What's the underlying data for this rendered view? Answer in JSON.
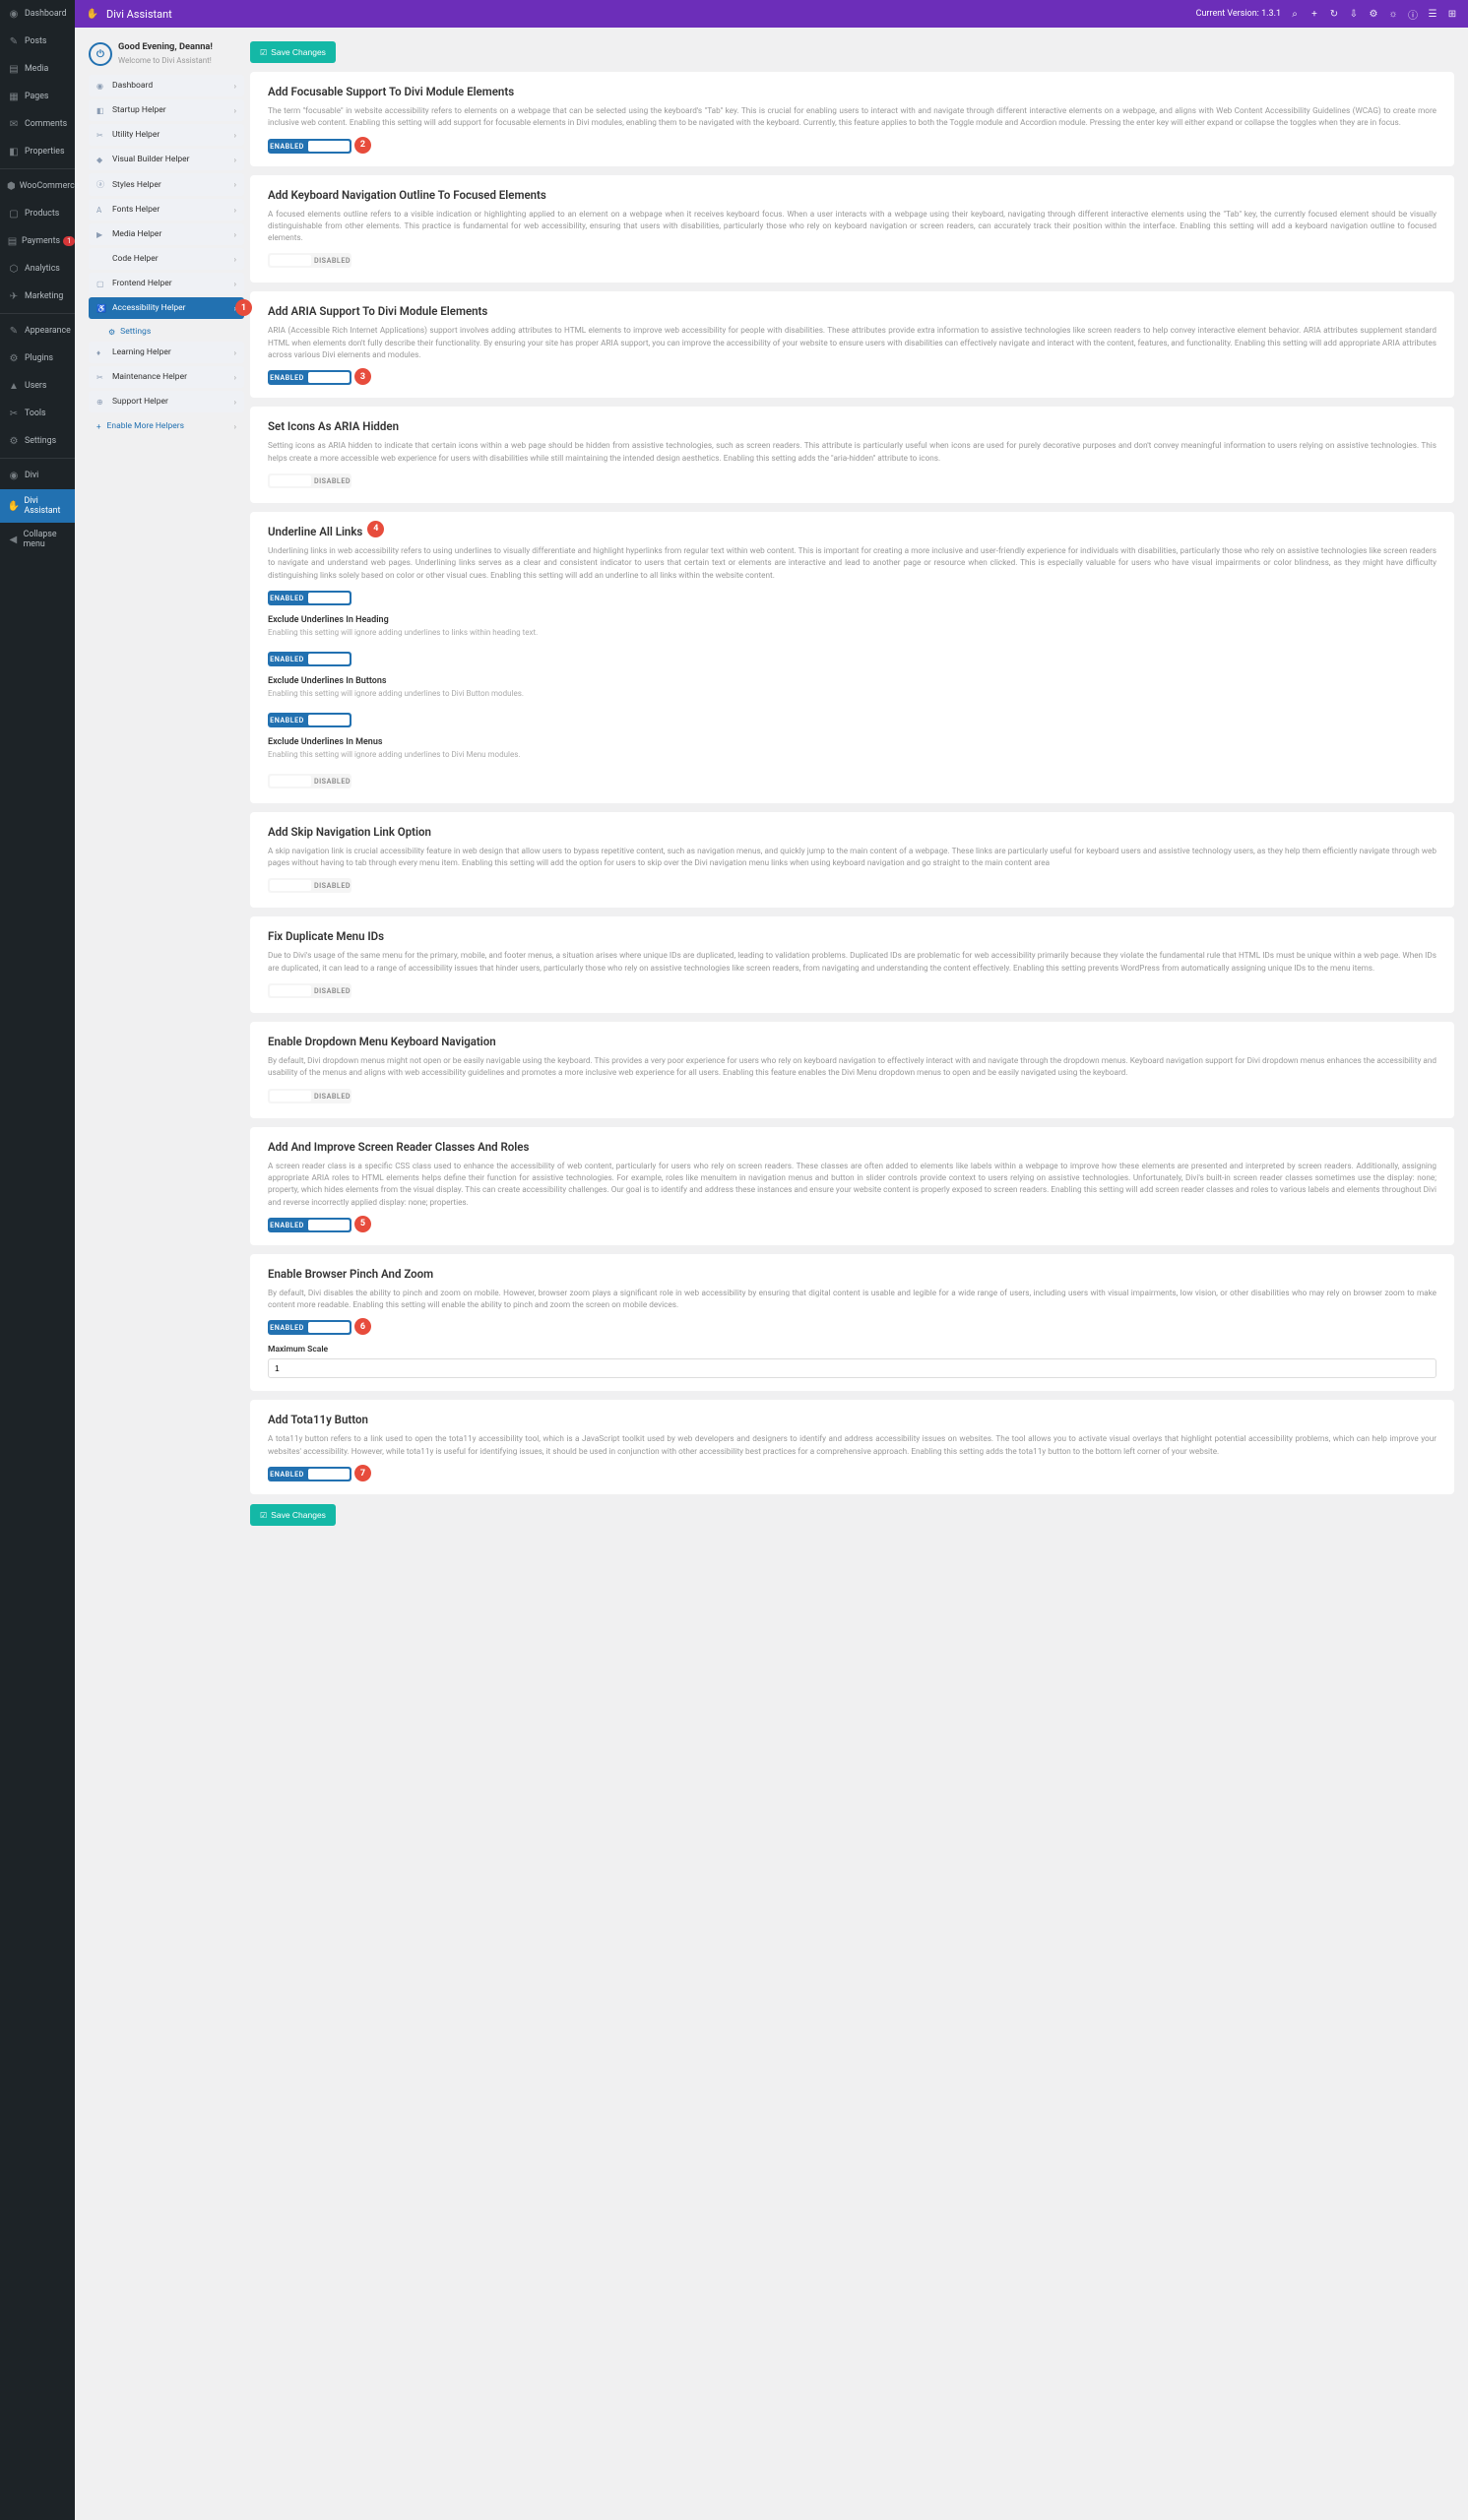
{
  "wp_menu": [
    {
      "icon": "◉",
      "label": "Dashboard",
      "badge": null
    },
    {
      "icon": "✎",
      "label": "Posts",
      "badge": null
    },
    {
      "icon": "▤",
      "label": "Media",
      "badge": null
    },
    {
      "icon": "▦",
      "label": "Pages",
      "badge": null
    },
    {
      "icon": "✉",
      "label": "Comments",
      "badge": null
    },
    {
      "icon": "◧",
      "label": "Properties",
      "badge": null
    },
    {
      "icon": "-",
      "label": "",
      "badge": null
    },
    {
      "icon": "⬢",
      "label": "WooCommerce",
      "badge": null
    },
    {
      "icon": "▢",
      "label": "Products",
      "badge": null
    },
    {
      "icon": "▤",
      "label": "Payments",
      "badge": "1"
    },
    {
      "icon": "⬡",
      "label": "Analytics",
      "badge": null
    },
    {
      "icon": "✈",
      "label": "Marketing",
      "badge": null
    },
    {
      "icon": "-",
      "label": "",
      "badge": null
    },
    {
      "icon": "✎",
      "label": "Appearance",
      "badge": null
    },
    {
      "icon": "⚙",
      "label": "Plugins",
      "badge": null
    },
    {
      "icon": "▲",
      "label": "Users",
      "badge": null
    },
    {
      "icon": "✂",
      "label": "Tools",
      "badge": null
    },
    {
      "icon": "⚙",
      "label": "Settings",
      "badge": null
    },
    {
      "icon": "-",
      "label": "",
      "badge": null
    },
    {
      "icon": "◉",
      "label": "Divi",
      "badge": null
    },
    {
      "icon": "✋",
      "label": "Divi Assistant",
      "badge": null,
      "active": true
    },
    {
      "icon": "◀",
      "label": "Collapse menu",
      "badge": null
    }
  ],
  "topbar": {
    "title": "Divi Assistant",
    "version_label": "Current Version:",
    "version": "1.3.1"
  },
  "greeting": {
    "title": "Good Evening, Deanna!",
    "sub": "Welcome to Divi Assistant!"
  },
  "helpers": [
    {
      "icon": "◉",
      "label": "Dashboard"
    },
    {
      "icon": "◧",
      "label": "Startup Helper"
    },
    {
      "icon": "✂",
      "label": "Utility Helper"
    },
    {
      "icon": "◆",
      "label": "Visual Builder Helper"
    },
    {
      "icon": "ⓐ",
      "label": "Styles Helper"
    },
    {
      "icon": "A",
      "label": "Fonts Helper"
    },
    {
      "icon": "▶",
      "label": "Media Helper"
    },
    {
      "icon": "</>",
      "label": "Code Helper"
    },
    {
      "icon": "▢",
      "label": "Frontend Helper"
    },
    {
      "icon": "♿",
      "label": "Accessibility Helper",
      "active": true
    },
    {
      "icon": "⚙",
      "label": "Settings",
      "sub": true
    },
    {
      "icon": "♦",
      "label": "Learning Helper"
    },
    {
      "icon": "✂",
      "label": "Maintenance Helper"
    },
    {
      "icon": "⊕",
      "label": "Support Helper"
    }
  ],
  "enable_more": {
    "label": "Enable More Helpers"
  },
  "save_label": "Save Changes",
  "badges": [
    "1",
    "2",
    "3",
    "4",
    "5",
    "6",
    "7"
  ],
  "sections": [
    {
      "title": "Add Focusable Support To Divi Module Elements",
      "desc": "The term \"focusable\" in website accessibility refers to elements on a webpage that can be selected using the keyboard's \"Tab\" key. This is crucial for enabling users to interact with and navigate through different interactive elements on a webpage, and aligns with Web Content Accessibility Guidelines (WCAG) to create more inclusive web content. Enabling this setting will add support for focusable elements in Divi modules, enabling them to be navigated with the keyboard. Currently, this feature applies to both the Toggle module and Accordion module. Pressing the enter key will either expand or collapse the toggles when they are in focus.",
      "state": "on",
      "badge": "2"
    },
    {
      "title": "Add Keyboard Navigation Outline To Focused Elements",
      "desc": "A focused elements outline refers to a visible indication or highlighting applied to an element on a webpage when it receives keyboard focus. When a user interacts with a webpage using their keyboard, navigating through different interactive elements using the \"Tab\" key, the currently focused element should be visually distinguishable from other elements. This practice is fundamental for web accessibility, ensuring that users with disabilities, particularly those who rely on keyboard navigation or screen readers, can accurately track their position within the interface. Enabling this setting will add a keyboard navigation outline to focused elements.",
      "state": "off"
    },
    {
      "title": "Add ARIA Support To Divi Module Elements",
      "desc": "ARIA (Accessible Rich Internet Applications) support involves adding attributes to HTML elements to improve web accessibility for people with disabilities. These attributes provide extra information to assistive technologies like screen readers to help convey interactive element behavior. ARIA attributes supplement standard HTML when elements don't fully describe their functionality. By ensuring your site has proper ARIA support, you can improve the accessibility of your website to ensure users with disabilities can effectively navigate and interact with the content, features, and functionality. Enabling this setting will add appropriate ARIA attributes across various Divi elements and modules.",
      "state": "on",
      "badge": "3"
    },
    {
      "title": "Set Icons As ARIA Hidden",
      "desc": "Setting icons as ARIA hidden to indicate that certain icons within a web page should be hidden from assistive technologies, such as screen readers. This attribute is particularly useful when icons are used for purely decorative purposes and don't convey meaningful information to users relying on assistive technologies. This helps create a more accessible web experience for users with disabilities while still maintaining the intended design aesthetics. Enabling this setting adds the \"aria-hidden\" attribute to icons.",
      "state": "off"
    },
    {
      "title": "Underline All Links",
      "title_badge": "4",
      "desc": "Underlining links in web accessibility refers to using underlines to visually differentiate and highlight hyperlinks from regular text within web content. This is important for creating a more inclusive and user-friendly experience for individuals with disabilities, particularly those who rely on assistive technologies like screen readers to navigate and understand web pages. Underlining links serves as a clear and consistent indicator to users that certain text or elements are interactive and lead to another page or resource when clicked. This is especially valuable for users who have visual impairments or color blindness, as they might have difficulty distinguishing links solely based on color or other visual cues. Enabling this setting will add an underline to all links within the website content.",
      "state": "on",
      "subs": [
        {
          "title": "Exclude Underlines In Heading",
          "note": "Enabling this setting will ignore adding underlines to links within heading text.",
          "state": "on"
        },
        {
          "title": "Exclude Underlines In Buttons",
          "note": "Enabling this setting will ignore adding underlines to Divi Button modules.",
          "state": "on"
        },
        {
          "title": "Exclude Underlines In Menus",
          "note": "Enabling this setting will ignore adding underlines to Divi Menu modules.",
          "state": "off"
        }
      ]
    },
    {
      "title": "Add Skip Navigation Link Option",
      "desc": "A skip navigation link is crucial accessibility feature in web design that allow users to bypass repetitive content, such as navigation menus, and quickly jump to the main content of a webpage. These links are particularly useful for keyboard users and assistive technology users, as they help them efficiently navigate through web pages without having to tab through every menu item. Enabling this setting will add the option for users to skip over the Divi navigation menu links when using keyboard navigation and go straight to the main content area",
      "state": "off"
    },
    {
      "title": "Fix Duplicate Menu IDs",
      "desc": "Due to Divi's usage of the same menu for the primary, mobile, and footer menus, a situation arises where unique IDs are duplicated, leading to validation problems. Duplicated IDs are problematic for web accessibility primarily because they violate the fundamental rule that HTML IDs must be unique within a web page. When IDs are duplicated, it can lead to a range of accessibility issues that hinder users, particularly those who rely on assistive technologies like screen readers, from navigating and understanding the content effectively. Enabling this setting prevents WordPress from automatically assigning unique IDs to the menu items.",
      "state": "off"
    },
    {
      "title": "Enable Dropdown Menu Keyboard Navigation",
      "desc": "By default, Divi dropdown menus might not open or be easily navigable using the keyboard. This provides a very poor experience for users who rely on keyboard navigation to effectively interact with and navigate through the dropdown menus. Keyboard navigation support for Divi dropdown menus enhances the accessibility and usability of the menus and aligns with web accessibility guidelines and promotes a more inclusive web experience for all users. Enabling this feature enables the Divi Menu dropdown menus to open and be easily navigated using the keyboard.",
      "state": "off"
    },
    {
      "title": "Add And Improve Screen Reader Classes And Roles",
      "desc": "A screen reader class is a specific CSS class used to enhance the accessibility of web content, particularly for users who rely on screen readers. These classes are often added to elements like labels within a webpage to improve how these elements are presented and interpreted by screen readers. Additionally, assigning appropriate ARIA roles to HTML elements helps define their function for assistive technologies. For example, roles like menuitem in navigation menus and button in slider controls provide context to users relying on assistive technologies. Unfortunately, Divi's built-in screen reader classes sometimes use the display: none; property, which hides elements from the visual display. This can create accessibility challenges. Our goal is to identify and address these instances and ensure your website content is properly exposed to screen readers. Enabling this setting will add screen reader classes and roles to various labels and elements throughout Divi and reverse incorrectly applied display: none; properties.",
      "state": "on",
      "badge": "5"
    },
    {
      "title": "Enable Browser Pinch And Zoom",
      "desc": "By default, Divi disables the ability to pinch and zoom on mobile. However, browser zoom plays a significant role in web accessibility by ensuring that digital content is usable and legible for a wide range of users, including users with visual impairments, low vision, or other disabilities who may rely on browser zoom to make content more readable. Enabling this setting will enable the ability to pinch and zoom the screen on mobile devices.",
      "state": "on",
      "badge": "6",
      "max_scale": {
        "label": "Maximum Scale",
        "value": "1"
      }
    },
    {
      "title": "Add Tota11y Button",
      "desc": "A tota11y button refers to a link used to open the tota11y accessibility tool, which is a JavaScript toolkit used by web developers and designers to identify and address accessibility issues on websites. The tool allows you to activate visual overlays that highlight potential accessibility problems, which can help improve your websites' accessibility. However, while tota11y is useful for identifying issues, it should be used in conjunction with other accessibility best practices for a comprehensive approach. Enabling this setting adds the tota11y button to the bottom left corner of your website.",
      "state": "on",
      "badge": "7"
    }
  ],
  "toggle_labels": {
    "on": "ENABLED",
    "off": "DISABLED"
  }
}
